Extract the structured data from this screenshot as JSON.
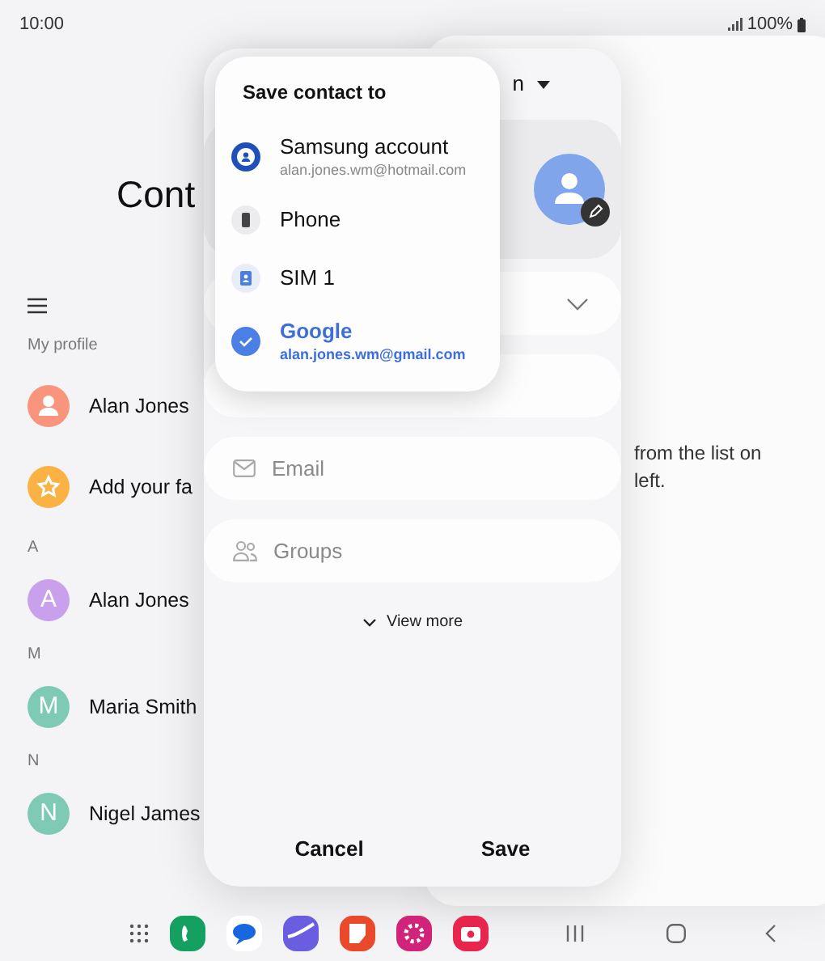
{
  "status_bar": {
    "time": "10:00",
    "battery": "100%"
  },
  "contacts": {
    "title": "Cont",
    "sections": [
      {
        "header": "My profile",
        "items": [
          {
            "kind": "profile",
            "name": "Alan Jones",
            "color": "#f9957c"
          },
          {
            "kind": "favorites",
            "name": "Add your fa",
            "color": "#fbb244"
          }
        ]
      },
      {
        "header": "A",
        "items": [
          {
            "kind": "letter",
            "initial": "A",
            "name": "Alan Jones",
            "color": "#c9a0ec"
          }
        ]
      },
      {
        "header": "M",
        "items": [
          {
            "kind": "letter",
            "initial": "M",
            "name": "Maria Smith",
            "color": "#7fcab5"
          }
        ]
      },
      {
        "header": "N",
        "items": [
          {
            "kind": "letter",
            "initial": "N",
            "name": "Nigel James",
            "color": "#7fcab5"
          }
        ]
      }
    ]
  },
  "detail_pane": {
    "lines": [
      "from the list on",
      "left."
    ]
  },
  "dialog": {
    "account_label": "n",
    "fields": [
      {
        "kind": "select"
      },
      {
        "kind": "phone"
      },
      {
        "kind": "email",
        "placeholder": "Email"
      },
      {
        "kind": "groups",
        "placeholder": "Groups"
      }
    ],
    "view_more": "View more",
    "buttons": [
      "Cancel",
      "Save"
    ]
  },
  "popup": {
    "title": "Save contact to",
    "options": [
      {
        "kind": "samsung",
        "label": "Samsung account",
        "account": "alan.jones.wm@hotmail.com",
        "selected": false
      },
      {
        "kind": "phone",
        "label": "Phone",
        "selected": false
      },
      {
        "kind": "sim",
        "label": "SIM 1",
        "selected": false
      },
      {
        "kind": "google",
        "label": "Google",
        "account": "alan.jones.wm@gmail.com",
        "selected": true
      }
    ]
  }
}
